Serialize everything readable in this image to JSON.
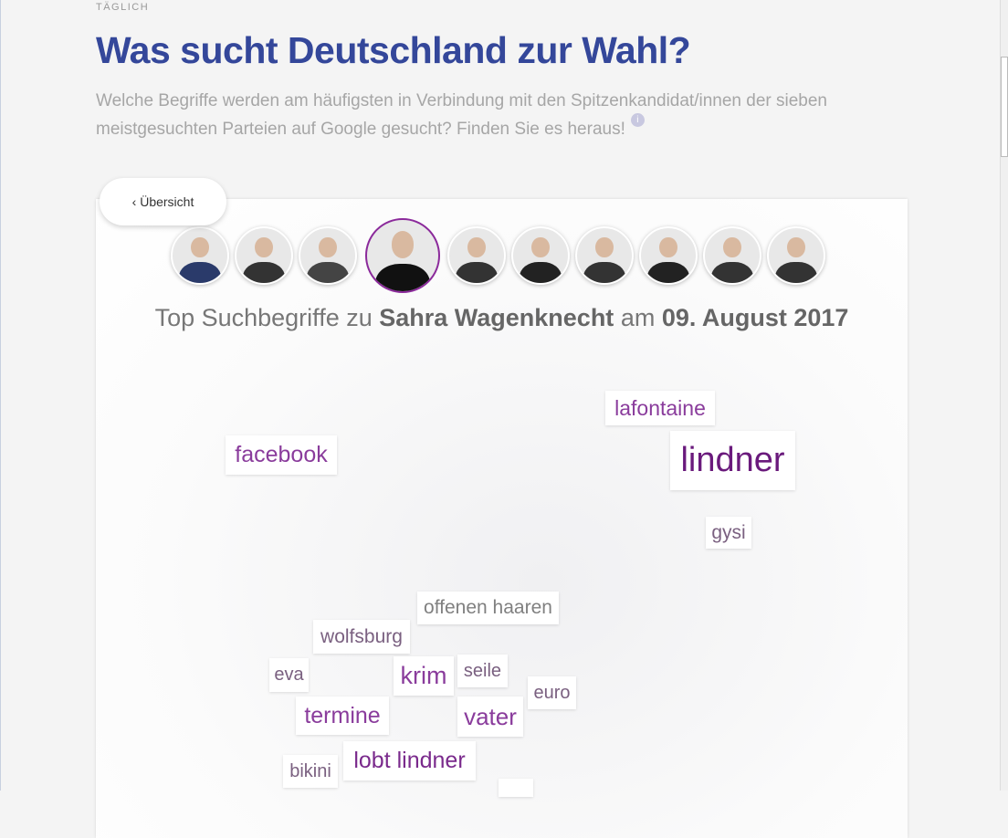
{
  "header": {
    "kicker": "TÄGLICH",
    "title": "Was sucht Deutschland zur Wahl?",
    "subtitle": "Welche Begriffe werden am häufigsten in Verbindung mit den Spitzenkandidat/innen der sieben meistgesuchten Parteien auf Google gesucht? Finden Sie es heraus!",
    "info_icon": "i"
  },
  "back_button": {
    "label": "‹  Übersicht"
  },
  "candidates": {
    "count": 10,
    "selected_index": 3
  },
  "result": {
    "prefix": "Top Suchbegriffe zu ",
    "name": "Sahra Wagenknecht",
    "mid": " am ",
    "date": "09. August 2017"
  },
  "colors": {
    "title": "#34479a",
    "accent": "#8b2a9b"
  },
  "words": [
    {
      "text": "lafontaine",
      "color": "#8a3c9c"
    },
    {
      "text": "facebook",
      "color": "#8a3c9c"
    },
    {
      "text": "lindner",
      "color": "#6a1a7c"
    },
    {
      "text": "gysi",
      "color": "#7a6080"
    },
    {
      "text": "offenen haaren",
      "color": "#808080"
    },
    {
      "text": "wolfsburg",
      "color": "#7a6080"
    },
    {
      "text": "eva",
      "color": "#7a6080"
    },
    {
      "text": "krim",
      "color": "#8a3c9c"
    },
    {
      "text": "seile",
      "color": "#7a6080"
    },
    {
      "text": "euro",
      "color": "#7a6080"
    },
    {
      "text": "termine",
      "color": "#8a3c9c"
    },
    {
      "text": "vater",
      "color": "#8a3c9c"
    },
    {
      "text": "bikini",
      "color": "#7a6080"
    },
    {
      "text": "lobt lindner",
      "color": "#7a2a8c"
    }
  ]
}
